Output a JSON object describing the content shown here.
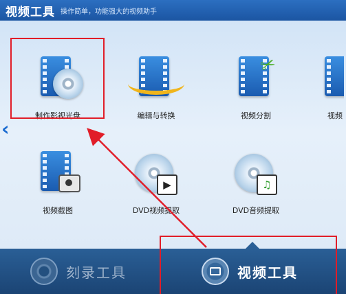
{
  "window": {
    "title": "视频工具",
    "subtitle": "操作简单，功能强大的视频助手"
  },
  "tools": [
    {
      "id": "make-dvd",
      "label": "制作影视光盘",
      "icon": "film-disc-icon"
    },
    {
      "id": "edit-convert",
      "label": "编辑与转换",
      "icon": "film-arc-icon"
    },
    {
      "id": "split",
      "label": "视频分割",
      "icon": "film-scissors-icon"
    },
    {
      "id": "partial",
      "label": "视频",
      "icon": "film-icon"
    },
    {
      "id": "screenshot",
      "label": "视频截图",
      "icon": "film-camera-icon"
    },
    {
      "id": "dvd-video",
      "label": "DVD视频提取",
      "icon": "disc-play-icon"
    },
    {
      "id": "dvd-audio",
      "label": "DVD音频提取",
      "icon": "disc-music-icon"
    }
  ],
  "nav": {
    "left_arrow": "‹"
  },
  "bottom_tabs": [
    {
      "label": "刻录工具",
      "active": false
    },
    {
      "label": "视频工具",
      "active": true
    }
  ],
  "colors": {
    "accent": "#1b55a2",
    "highlight": "#e11d28",
    "bottom_bar": "#1b4474"
  }
}
